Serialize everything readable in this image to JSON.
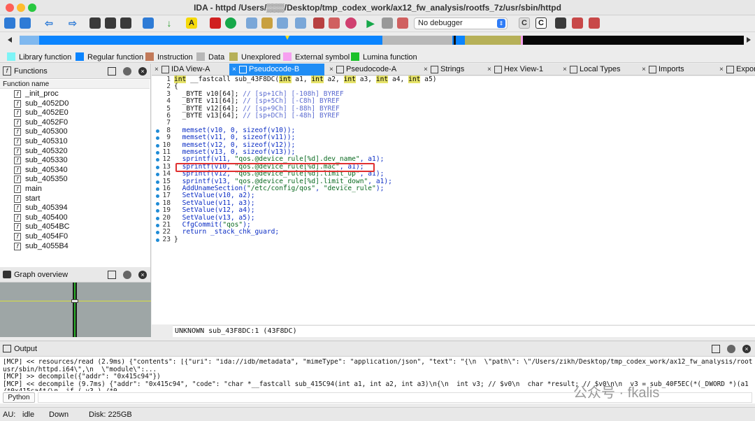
{
  "window": {
    "title": "IDA - httpd /Users/▒▒▒/Desktop/tmp_codex_work/ax12_fw_analysis/rootfs_7z/usr/sbin/httpd"
  },
  "toolbar": {
    "debugger_select": "No debugger"
  },
  "legend": [
    {
      "label": "Library function",
      "color": "#7ef4f6"
    },
    {
      "label": "Regular function",
      "color": "#0a84ff"
    },
    {
      "label": "Instruction",
      "color": "#c27a5a"
    },
    {
      "label": "Data",
      "color": "#b8b8b8"
    },
    {
      "label": "Unexplored",
      "color": "#b6b058"
    },
    {
      "label": "External symbol",
      "color": "#f6a0f0"
    },
    {
      "label": "Lumina function",
      "color": "#1cc12a"
    }
  ],
  "functions_panel": {
    "title": "Functions",
    "column": "Function name",
    "items": [
      "_init_proc",
      "sub_4052D0",
      "sub_4052E0",
      "sub_4052F0",
      "sub_405300",
      "sub_405310",
      "sub_405320",
      "sub_405330",
      "sub_405340",
      "sub_405350",
      "main",
      "start",
      "sub_405394",
      "sub_405400",
      "sub_4054BC",
      "sub_4054F0",
      "sub_4055B4"
    ]
  },
  "graph_panel": {
    "title": "Graph overview"
  },
  "tabs": [
    {
      "label": "IDA View-A",
      "active": false
    },
    {
      "label": "Pseudocode-B",
      "active": true
    },
    {
      "label": "Pseudocode-A",
      "active": false
    },
    {
      "label": "Strings",
      "active": false
    },
    {
      "label": "Hex View-1",
      "active": false
    },
    {
      "label": "Local Types",
      "active": false
    },
    {
      "label": "Imports",
      "active": false
    },
    {
      "label": "Exports",
      "active": false
    }
  ],
  "code_lines": [
    {
      "n": "1",
      "dot": false,
      "html": "<span class='kw'>int</span> __fastcall sub_43F8DC(<span class='kw'>int</span> a1, <span class='kw'>int</span> a2, <span class='kw'>int</span> a3, <span class='kw'>int</span> a4, <span class='kw'>int</span> a5)"
    },
    {
      "n": "2",
      "dot": false,
      "html": "{"
    },
    {
      "n": "3",
      "dot": false,
      "html": "  _BYTE v10[64]; <span class='cm'>// [sp+1Ch] [-108h] BYREF</span>"
    },
    {
      "n": "4",
      "dot": false,
      "html": "  _BYTE v11[64]; <span class='cm'>// [sp+5Ch] [-C8h] BYREF</span>"
    },
    {
      "n": "5",
      "dot": false,
      "html": "  _BYTE v12[64]; <span class='cm'>// [sp+9Ch] [-88h] BYREF</span>"
    },
    {
      "n": "6",
      "dot": false,
      "html": "  _BYTE v13[64]; <span class='cm'>// [sp+DCh] [-48h] BYREF</span>"
    },
    {
      "n": "7",
      "dot": false,
      "html": ""
    },
    {
      "n": "8",
      "dot": true,
      "html": "  <span class='bl'>memset(v10, 0, sizeof(v10));</span>"
    },
    {
      "n": "9",
      "dot": true,
      "html": "  <span class='bl'>memset(v11, 0, sizeof(v11));</span>"
    },
    {
      "n": "10",
      "dot": true,
      "html": "  <span class='bl'>memset(v12, 0, sizeof(v12));</span>"
    },
    {
      "n": "11",
      "dot": true,
      "html": "  <span class='bl'>memset(v13, 0, sizeof(v13));</span>"
    },
    {
      "n": "12",
      "dot": true,
      "html": "  <span class='bl'>sprintf(v11, <span class='st'>\"qos.@device_rule[%d].dev_name\"</span>, a1);</span>"
    },
    {
      "n": "13",
      "dot": true,
      "html": "  <span class='bl'>sprintf(v10, <span class='st'>\"qos.@device_rule[%d].mac\"</span>, a1);</span>"
    },
    {
      "n": "14",
      "dot": true,
      "html": "  <span class='bl'>sprintf(v12, <span class='st'>\"qos.@device_rule[%d].limit_up\"</span>, a1);</span>"
    },
    {
      "n": "15",
      "dot": true,
      "html": "  <span class='bl'>sprintf(v13, <span class='st'>\"qos.@device_rule[%d].limit_down\"</span>, a1);</span>"
    },
    {
      "n": "16",
      "dot": true,
      "html": "  <span class='bl'>AddUnameSection(<span class='st'>\"/etc/config/qos\"</span>, <span class='st'>\"device_rule\"</span>);</span>"
    },
    {
      "n": "17",
      "dot": true,
      "html": "  <span class='bl'>SetValue(v10, a2);</span>"
    },
    {
      "n": "18",
      "dot": true,
      "html": "  <span class='bl'>SetValue(v11, a3);</span>"
    },
    {
      "n": "19",
      "dot": true,
      "html": "  <span class='bl'>SetValue(v12, a4);</span>"
    },
    {
      "n": "20",
      "dot": true,
      "html": "  <span class='bl'>SetValue(v13, a5);</span>"
    },
    {
      "n": "21",
      "dot": true,
      "html": "  <span class='bl'>CfgCommit(<span class='st'>\"qos\"</span>);</span>"
    },
    {
      "n": "22",
      "dot": true,
      "html": "  <span class='bl'>return _stack_chk_guard;</span>"
    },
    {
      "n": "23",
      "dot": true,
      "html": "}"
    }
  ],
  "code_status": "UNKNOWN sub_43F8DC:1 (43F8DC)",
  "output_panel": {
    "title": "Output",
    "lines": [
      "[MCP] << resources/read (2.9ms) {\"contents\": [{\"uri\": \"ida://idb/metadata\", \"mimeType\": \"application/json\", \"text\": \"{\\n  \\\"path\\\": \\\"/Users/zikh/Desktop/tmp_codex_work/ax12_fw_analysis/rootfs_7z/",
      "usr/sbin/httpd.i64\\\",\\n  \\\"module\\\":...",
      "[MCP] >> decompile({\"addr\": \"0x415c94\"})",
      "[MCP] << decompile (9.7ms) {\"addr\": \"0x415c94\", \"code\": \"char *__fastcall sub_415C94(int a1, int a2, int a3)\\n{\\n  int v3; // $v0\\n  char *result; // $v0\\n\\n  v3 = sub_40F5EC(*(_DWORD *)(a1 + 32));",
      "/*0x415ca4*/\\n  if ( v3 ) /*0..."
    ],
    "python_button": "Python"
  },
  "status_bar": {
    "au": "AU:",
    "state": "idle",
    "dir": "Down",
    "disk": "Disk: 225GB"
  },
  "watermark": "公众号 · fkalis"
}
